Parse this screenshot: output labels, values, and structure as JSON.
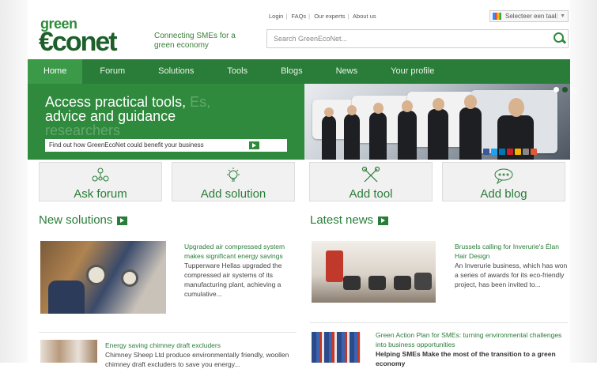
{
  "header": {
    "logo_top": "green",
    "logo_main_a": "€co",
    "logo_main_b": "net",
    "tagline": "Connecting SMEs for a green economy",
    "links": [
      "Login",
      "FAQs",
      "Our experts",
      "About us"
    ],
    "language": "Selecteer een taal",
    "search_placeholder": "Search GreenEcoNet..."
  },
  "nav": {
    "items": [
      "Home",
      "Forum",
      "Solutions",
      "Tools",
      "Blogs",
      "News",
      "Your profile"
    ],
    "active": "Home"
  },
  "hero": {
    "line1": "Access practical tools,",
    "line1_faded": "Es,",
    "line2": "advice and guidance",
    "line3_faded": "researchers",
    "cta": "Find out how GreenEcoNet could benefit your business"
  },
  "tiles": [
    "Ask forum",
    "Add solution",
    "Add tool",
    "Add blog"
  ],
  "new_solutions": {
    "title": "New solutions",
    "story1": {
      "title": "Upgraded air compressed system makes significant energy savings",
      "text": "Tupperware Hellas upgraded the compressed air systems of its manufacturing plant, achieving a cumulative..."
    },
    "story2": {
      "title": "Energy saving chimney draft excluders",
      "text": "Chimney Sheep Ltd produce environmentally friendly, woollen chimney draft excluders to save you energy..."
    }
  },
  "latest_news": {
    "title": "Latest news",
    "story1": {
      "title": "Brussels calling for Inverurie's Élan Hair Design",
      "text": "An Inverurie business, which has won a series of awards for its eco-friendly project, has been invited to..."
    },
    "story2": {
      "title": "Green Action Plan for SMEs: turning environmental challenges into business opportunities",
      "text": "Helping SMEs Make the most of the transition to a green economy"
    }
  },
  "colors": {
    "brand_green": "#2a7d39",
    "hero_green": "#2f8a3d"
  },
  "icons": [
    "search-icon",
    "network-icon",
    "lightbulb-icon",
    "tools-icon",
    "speech-bubble-icon",
    "arrow-right-icon"
  ]
}
